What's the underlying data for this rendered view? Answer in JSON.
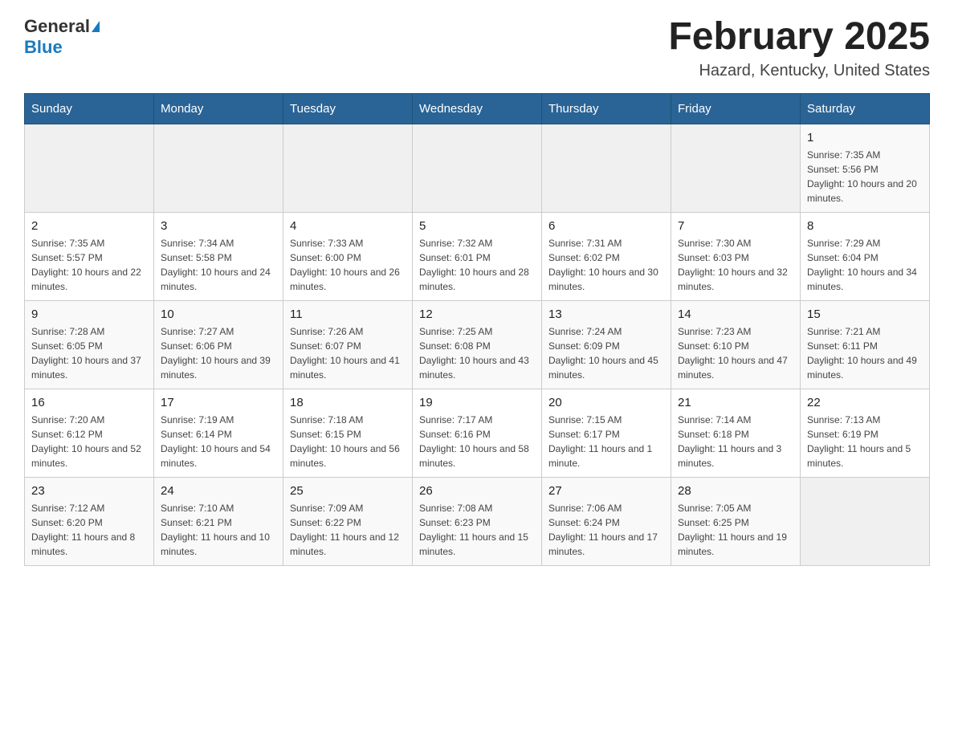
{
  "header": {
    "logo_general": "General",
    "logo_blue": "Blue",
    "title": "February 2025",
    "subtitle": "Hazard, Kentucky, United States"
  },
  "days_of_week": [
    "Sunday",
    "Monday",
    "Tuesday",
    "Wednesday",
    "Thursday",
    "Friday",
    "Saturday"
  ],
  "weeks": [
    [
      {
        "day": "",
        "info": ""
      },
      {
        "day": "",
        "info": ""
      },
      {
        "day": "",
        "info": ""
      },
      {
        "day": "",
        "info": ""
      },
      {
        "day": "",
        "info": ""
      },
      {
        "day": "",
        "info": ""
      },
      {
        "day": "1",
        "info": "Sunrise: 7:35 AM\nSunset: 5:56 PM\nDaylight: 10 hours and 20 minutes."
      }
    ],
    [
      {
        "day": "2",
        "info": "Sunrise: 7:35 AM\nSunset: 5:57 PM\nDaylight: 10 hours and 22 minutes."
      },
      {
        "day": "3",
        "info": "Sunrise: 7:34 AM\nSunset: 5:58 PM\nDaylight: 10 hours and 24 minutes."
      },
      {
        "day": "4",
        "info": "Sunrise: 7:33 AM\nSunset: 6:00 PM\nDaylight: 10 hours and 26 minutes."
      },
      {
        "day": "5",
        "info": "Sunrise: 7:32 AM\nSunset: 6:01 PM\nDaylight: 10 hours and 28 minutes."
      },
      {
        "day": "6",
        "info": "Sunrise: 7:31 AM\nSunset: 6:02 PM\nDaylight: 10 hours and 30 minutes."
      },
      {
        "day": "7",
        "info": "Sunrise: 7:30 AM\nSunset: 6:03 PM\nDaylight: 10 hours and 32 minutes."
      },
      {
        "day": "8",
        "info": "Sunrise: 7:29 AM\nSunset: 6:04 PM\nDaylight: 10 hours and 34 minutes."
      }
    ],
    [
      {
        "day": "9",
        "info": "Sunrise: 7:28 AM\nSunset: 6:05 PM\nDaylight: 10 hours and 37 minutes."
      },
      {
        "day": "10",
        "info": "Sunrise: 7:27 AM\nSunset: 6:06 PM\nDaylight: 10 hours and 39 minutes."
      },
      {
        "day": "11",
        "info": "Sunrise: 7:26 AM\nSunset: 6:07 PM\nDaylight: 10 hours and 41 minutes."
      },
      {
        "day": "12",
        "info": "Sunrise: 7:25 AM\nSunset: 6:08 PM\nDaylight: 10 hours and 43 minutes."
      },
      {
        "day": "13",
        "info": "Sunrise: 7:24 AM\nSunset: 6:09 PM\nDaylight: 10 hours and 45 minutes."
      },
      {
        "day": "14",
        "info": "Sunrise: 7:23 AM\nSunset: 6:10 PM\nDaylight: 10 hours and 47 minutes."
      },
      {
        "day": "15",
        "info": "Sunrise: 7:21 AM\nSunset: 6:11 PM\nDaylight: 10 hours and 49 minutes."
      }
    ],
    [
      {
        "day": "16",
        "info": "Sunrise: 7:20 AM\nSunset: 6:12 PM\nDaylight: 10 hours and 52 minutes."
      },
      {
        "day": "17",
        "info": "Sunrise: 7:19 AM\nSunset: 6:14 PM\nDaylight: 10 hours and 54 minutes."
      },
      {
        "day": "18",
        "info": "Sunrise: 7:18 AM\nSunset: 6:15 PM\nDaylight: 10 hours and 56 minutes."
      },
      {
        "day": "19",
        "info": "Sunrise: 7:17 AM\nSunset: 6:16 PM\nDaylight: 10 hours and 58 minutes."
      },
      {
        "day": "20",
        "info": "Sunrise: 7:15 AM\nSunset: 6:17 PM\nDaylight: 11 hours and 1 minute."
      },
      {
        "day": "21",
        "info": "Sunrise: 7:14 AM\nSunset: 6:18 PM\nDaylight: 11 hours and 3 minutes."
      },
      {
        "day": "22",
        "info": "Sunrise: 7:13 AM\nSunset: 6:19 PM\nDaylight: 11 hours and 5 minutes."
      }
    ],
    [
      {
        "day": "23",
        "info": "Sunrise: 7:12 AM\nSunset: 6:20 PM\nDaylight: 11 hours and 8 minutes."
      },
      {
        "day": "24",
        "info": "Sunrise: 7:10 AM\nSunset: 6:21 PM\nDaylight: 11 hours and 10 minutes."
      },
      {
        "day": "25",
        "info": "Sunrise: 7:09 AM\nSunset: 6:22 PM\nDaylight: 11 hours and 12 minutes."
      },
      {
        "day": "26",
        "info": "Sunrise: 7:08 AM\nSunset: 6:23 PM\nDaylight: 11 hours and 15 minutes."
      },
      {
        "day": "27",
        "info": "Sunrise: 7:06 AM\nSunset: 6:24 PM\nDaylight: 11 hours and 17 minutes."
      },
      {
        "day": "28",
        "info": "Sunrise: 7:05 AM\nSunset: 6:25 PM\nDaylight: 11 hours and 19 minutes."
      },
      {
        "day": "",
        "info": ""
      }
    ]
  ]
}
